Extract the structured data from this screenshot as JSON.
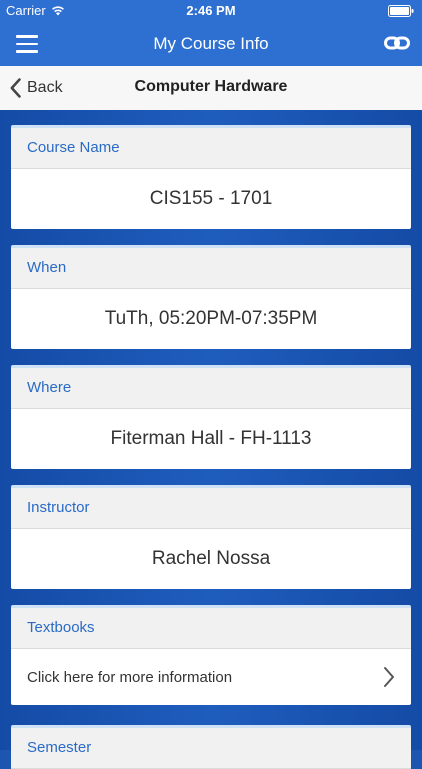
{
  "status_bar": {
    "carrier": "Carrier",
    "time": "2:46 PM"
  },
  "nav": {
    "title": "My Course Info"
  },
  "sub_nav": {
    "back_label": "Back",
    "title": "Computer Hardware"
  },
  "cards": {
    "course_name": {
      "label": "Course Name",
      "value": "CIS155 - 1701"
    },
    "when": {
      "label": "When",
      "value": "TuTh, 05:20PM-07:35PM"
    },
    "where": {
      "label": "Where",
      "value": "Fiterman Hall - FH-1113"
    },
    "instructor": {
      "label": "Instructor",
      "value": "Rachel Nossa"
    },
    "textbooks": {
      "label": "Textbooks",
      "link_text": "Click here for more information"
    },
    "semester": {
      "label": "Semester"
    }
  },
  "colors": {
    "nav_blue": "#2e6fd2",
    "label_blue": "#2a6bc6",
    "background_blue": "#1d56b0"
  }
}
